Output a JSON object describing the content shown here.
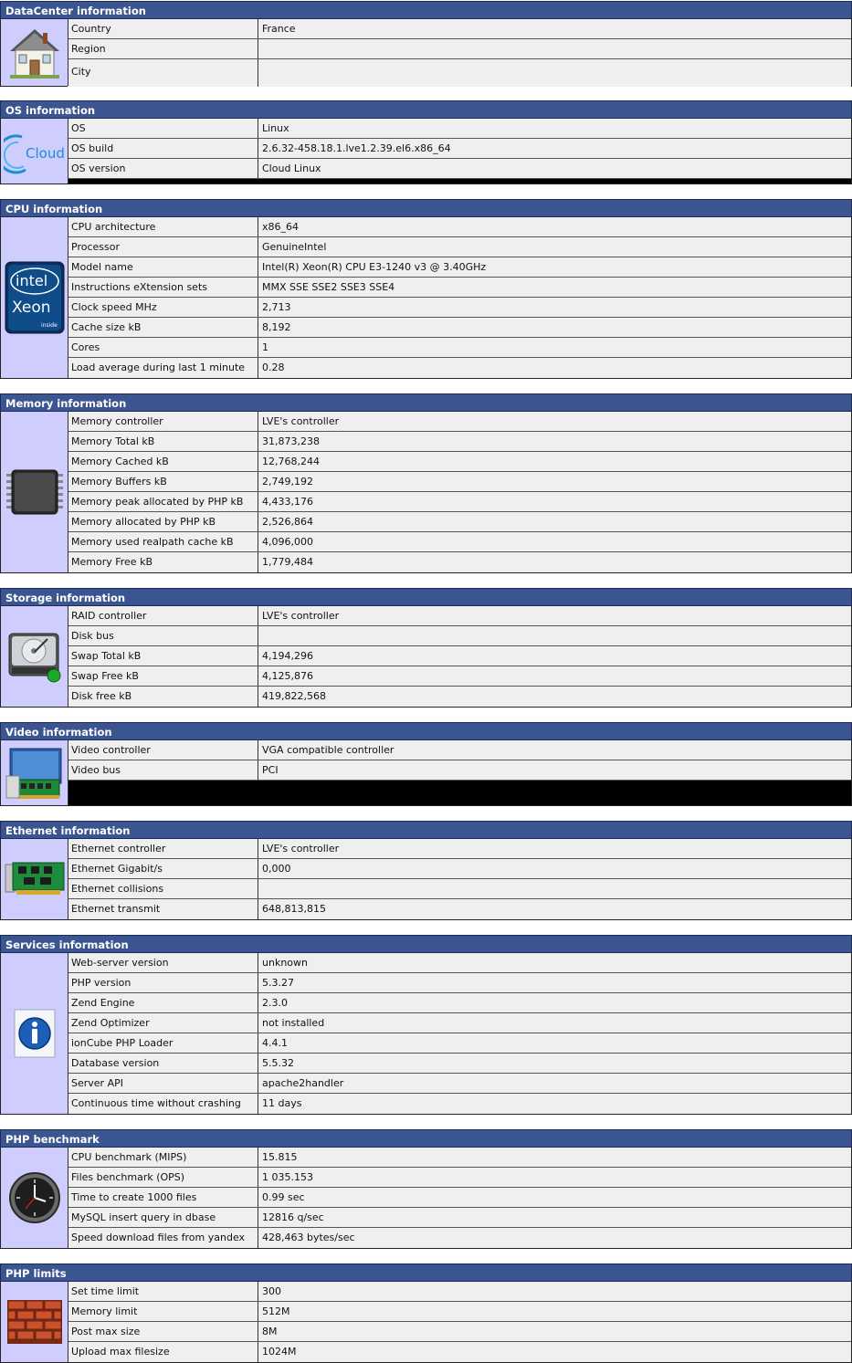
{
  "sections": [
    {
      "title": "DataCenter information",
      "icon": "house-icon",
      "rows": [
        {
          "k": "Country",
          "v": "France"
        },
        {
          "k": "Region",
          "v": ""
        },
        {
          "k": "City",
          "v": ""
        }
      ]
    },
    {
      "title": "OS information",
      "icon": "cloud-icon",
      "icon_text": "Cloud",
      "rows": [
        {
          "k": "OS",
          "v": "Linux"
        },
        {
          "k": "OS build",
          "v": "2.6.32-458.18.1.lve1.2.39.el6.x86_64"
        },
        {
          "k": "OS version",
          "v": "Cloud Linux"
        }
      ]
    },
    {
      "title": "CPU information",
      "icon": "intel-xeon-icon",
      "icon_text_1": "intel",
      "icon_text_2": "Xeon",
      "icon_text_3": "inside",
      "rows": [
        {
          "k": "CPU architecture",
          "v": "x86_64"
        },
        {
          "k": "Processor",
          "v": "GenuineIntel"
        },
        {
          "k": "Model name",
          "v": "Intel(R) Xeon(R) CPU E3-1240 v3 @ 3.40GHz"
        },
        {
          "k": "Instructions eXtension sets",
          "v": "MMX SSE SSE2 SSE3 SSE4"
        },
        {
          "k": "Clock speed MHz",
          "v": "2,713"
        },
        {
          "k": "Cache size kB",
          "v": "8,192"
        },
        {
          "k": "Cores",
          "v": "1"
        },
        {
          "k": "Load average during last 1 minute",
          "v": "0.28"
        }
      ]
    },
    {
      "title": "Memory information",
      "icon": "memory-chip-icon",
      "rows": [
        {
          "k": "Memory controller",
          "v": "LVE's controller"
        },
        {
          "k": "Memory Total kB",
          "v": "31,873,238"
        },
        {
          "k": "Memory Cached kB",
          "v": "12,768,244"
        },
        {
          "k": "Memory Buffers kB",
          "v": "2,749,192"
        },
        {
          "k": "Memory peak allocated by PHP kB",
          "v": "4,433,176"
        },
        {
          "k": "Memory allocated by PHP kB",
          "v": "2,526,864"
        },
        {
          "k": "Memory used realpath cache kB",
          "v": "4,096,000"
        },
        {
          "k": "Memory Free kB",
          "v": "1,779,484"
        }
      ]
    },
    {
      "title": "Storage information",
      "icon": "hard-disk-icon",
      "rows": [
        {
          "k": "RAID controller",
          "v": "LVE's controller"
        },
        {
          "k": "Disk bus",
          "v": ""
        },
        {
          "k": "Swap Total kB",
          "v": "4,194,296"
        },
        {
          "k": "Swap Free kB",
          "v": "4,125,876"
        },
        {
          "k": "Disk free kB",
          "v": "419,822,568"
        }
      ]
    },
    {
      "title": "Video information",
      "icon": "video-card-icon",
      "rows": [
        {
          "k": "Video controller",
          "v": "VGA compatible controller"
        },
        {
          "k": "Video bus",
          "v": "PCI"
        }
      ]
    },
    {
      "title": "Ethernet information",
      "icon": "network-card-icon",
      "rows": [
        {
          "k": "Ethernet controller",
          "v": "LVE's controller"
        },
        {
          "k": "Ethernet Gigabit/s",
          "v": "0,000"
        },
        {
          "k": "Ethernet collisions",
          "v": ""
        },
        {
          "k": "Ethernet transmit",
          "v": "648,813,815"
        }
      ]
    },
    {
      "title": "Services information",
      "icon": "info-icon",
      "rows": [
        {
          "k": "Web-server version",
          "v": "unknown"
        },
        {
          "k": "PHP version",
          "v": "5.3.27"
        },
        {
          "k": "Zend Engine",
          "v": "2.3.0"
        },
        {
          "k": "Zend Optimizer",
          "v": "not installed"
        },
        {
          "k": "ionCube PHP Loader",
          "v": "4.4.1"
        },
        {
          "k": "Database version",
          "v": "5.5.32"
        },
        {
          "k": "Server API",
          "v": "apache2handler"
        },
        {
          "k": "Continuous time without crashing",
          "v": "11 days"
        }
      ]
    },
    {
      "title": "PHP benchmark",
      "icon": "clock-icon",
      "rows": [
        {
          "k": "CPU benchmark (MIPS)",
          "v": "15.815"
        },
        {
          "k": "Files benchmark (OPS)",
          "v": "1 035.153"
        },
        {
          "k": "Time to create 1000 files",
          "v": "0.99 sec"
        },
        {
          "k": "MySQL insert query in dbase",
          "v": "12816 q/sec"
        },
        {
          "k": "Speed download files from yandex",
          "v": "428,463 bytes/sec"
        }
      ]
    },
    {
      "title": "PHP limits",
      "icon": "brick-wall-icon",
      "rows": [
        {
          "k": "Set time limit",
          "v": "300"
        },
        {
          "k": "Memory limit",
          "v": "512M"
        },
        {
          "k": "Post max size",
          "v": "8M"
        },
        {
          "k": "Upload max filesize",
          "v": "1024M"
        }
      ]
    }
  ]
}
